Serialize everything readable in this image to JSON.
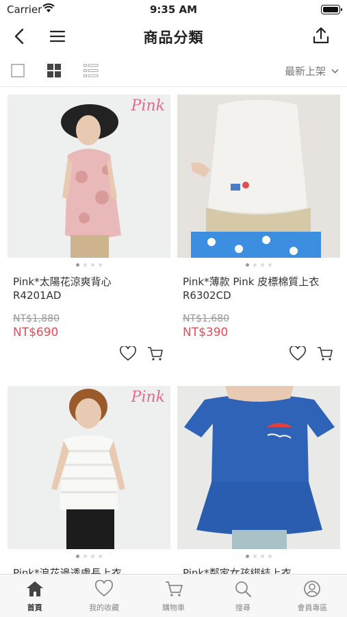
{
  "status": {
    "carrier": "Carrier",
    "time": "9:35 AM"
  },
  "header": {
    "title": "商品分類"
  },
  "toolbar": {
    "sort_label": "最新上架"
  },
  "products": [
    {
      "name": "Pink*太陽花涼爽背心\nR4201AD",
      "original_price": "NT$1,880",
      "price": "NT$690",
      "brand": "Pink"
    },
    {
      "name": "Pink*薄款 Pink 皮標棉質上衣\nR6302CD",
      "original_price": "NT$1,680",
      "price": "NT$390",
      "brand": ""
    },
    {
      "name": "Pink*浪花邊透膚長上衣",
      "original_price": "",
      "price": "",
      "brand": "Pink"
    },
    {
      "name": "Pink*鄰家女孩綁結上衣",
      "original_price": "",
      "price": "",
      "brand": ""
    }
  ],
  "tabbar": {
    "items": [
      {
        "label": "首頁",
        "icon": "home-icon"
      },
      {
        "label": "我的收藏",
        "icon": "heart-icon"
      },
      {
        "label": "購物車",
        "icon": "cart-icon"
      },
      {
        "label": "搜尋",
        "icon": "search-icon"
      },
      {
        "label": "會員專區",
        "icon": "user-icon"
      }
    ]
  }
}
